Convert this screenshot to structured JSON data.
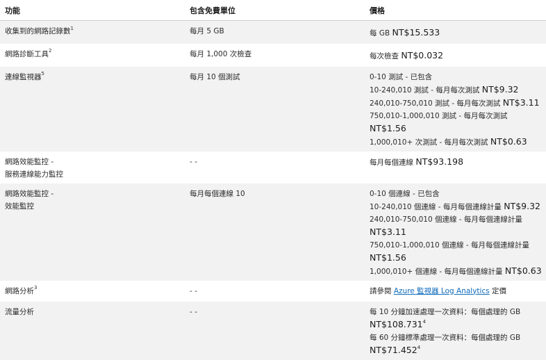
{
  "headers": {
    "feature": "功能",
    "free_units": "包含免費單位",
    "price": "價格"
  },
  "rows": {
    "r0": {
      "feature": "收集到的網路記錄數",
      "feature_sup": "1",
      "free": "每月 5 GB",
      "p0_text": "每 GB ",
      "p0_value": "NT$15.533"
    },
    "r1": {
      "feature": "網路診斷工具",
      "feature_sup": "2",
      "free": "每月 1,000 次檢查",
      "p0_text": "每次檢查 ",
      "p0_value": "NT$0.032"
    },
    "r2": {
      "feature": "連線監視器",
      "feature_sup": "5",
      "free": "每月 10 個測試",
      "p0_text": "0-10 測試 - 已包含",
      "p1_text": "10-240,010 測試 - 每月每次測試 ",
      "p1_value": "NT$9.32",
      "p2_text": "240,010-750,010 測試 - 每月每次測試 ",
      "p2_value": "NT$3.11",
      "p3_text": "750,010-1,000,010 測試 - 每月每次測試 ",
      "p3_value": "NT$1.56",
      "p4_text": "1,000,010+ 次測試 - 每月每次測試 ",
      "p4_value": "NT$0.63"
    },
    "r3": {
      "feature_l1": "網路效能監控 -",
      "feature_l2": "服務連線能力監控",
      "free": "- -",
      "p0_text": "每月每個連線 ",
      "p0_value": "NT$93.198"
    },
    "r4": {
      "feature_l1": "網路效能監控 -",
      "feature_l2": "效能監控",
      "free": "每月每個連線 10",
      "p0_text": "0-10 個連線 - 已包含",
      "p1_text": "10-240,010 個連線 - 每月每個連線計量 ",
      "p1_value": "NT$9.32",
      "p2_text": "240,010-750,010 個連線 - 每月每個連線計量 ",
      "p2_value": "NT$3.11",
      "p3_text": "750,010-1,000,010 個連線 - 每月每個連線計量 ",
      "p3_value": "NT$1.56",
      "p4_text": "1,000,010+ 個連線 - 每月每個連線計量 ",
      "p4_value": "NT$0.63"
    },
    "r5": {
      "feature": "網路分析",
      "feature_sup": "3",
      "free": "- -",
      "p0_pre": "請參閱 ",
      "p0_link": "Azure 監視器 Log Analytics",
      "p0_post": " 定價"
    },
    "r6": {
      "feature": "流量分析",
      "free": "- -",
      "p0_text": "每 10 分鐘加速處理一次資料：每個處理的 GB",
      "p1_value": "NT$108.731",
      "p1_sup": "4",
      "p2_text": "每 60 分鐘標準處理一次資料：每個處理的 GB",
      "p3_value": "NT$71.452",
      "p3_sup": "4"
    }
  },
  "colors": {
    "stripe": "#f2f2f2",
    "link": "#0f6cbd",
    "border": "#cfcfcf"
  }
}
